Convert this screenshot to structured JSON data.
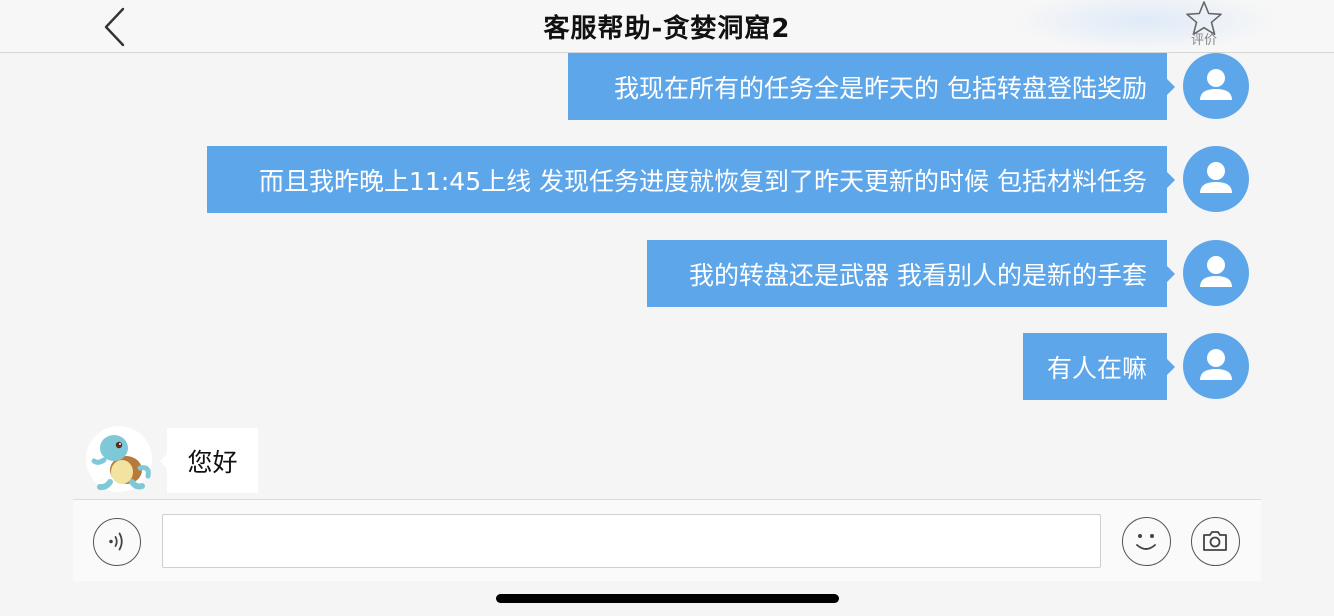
{
  "header": {
    "title": "客服帮助-贪婪洞窟2",
    "rate_label": "评价"
  },
  "messages": [
    {
      "from": "user",
      "text": "我现在所有的任务全是昨天的 包括转盘登陆奖励"
    },
    {
      "from": "user",
      "text": "而且我昨晚上11:45上线 发现任务进度就恢复到了昨天更新的时候 包括材料任务"
    },
    {
      "from": "user",
      "text": "我的转盘还是武器 我看别人的是新的手套"
    },
    {
      "from": "user",
      "text": "有人在嘛"
    },
    {
      "from": "agent",
      "text": "您好"
    }
  ],
  "input": {
    "value": "",
    "placeholder": ""
  },
  "colors": {
    "bubble_out": "#5ea6ea",
    "bubble_in": "#ffffff",
    "background": "#f5f5f5"
  },
  "icons": {
    "back": "chevron-left-icon",
    "rate": "star-outline-icon",
    "user_avatar": "person-icon",
    "voice": "voice-wave-icon",
    "emoji": "smiley-icon",
    "camera": "camera-icon"
  }
}
